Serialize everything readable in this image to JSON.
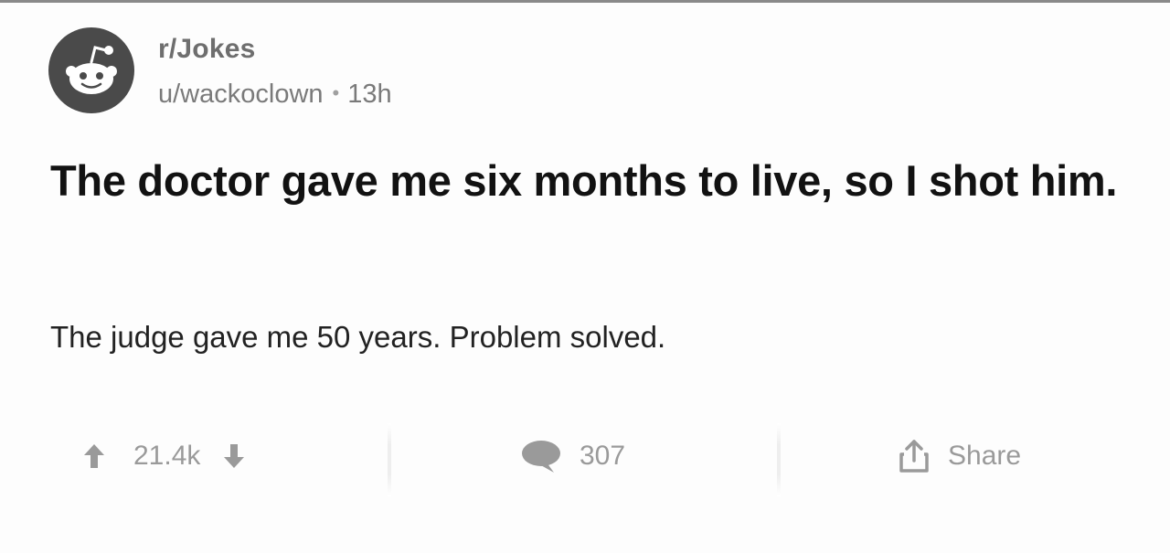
{
  "post": {
    "subreddit": "r/Jokes",
    "author": "u/wackoclown",
    "separator": "•",
    "age": "13h",
    "title": "The doctor gave me six months to live, so I shot him.",
    "body": "The judge gave me 50 years. Problem solved."
  },
  "actions": {
    "score": "21.4k",
    "comments": "307",
    "share_label": "Share"
  },
  "icons": {
    "avatar": "reddit-snoo-icon",
    "upvote": "upvote-arrow-icon",
    "downvote": "downvote-arrow-icon",
    "comment": "comment-bubble-icon",
    "share": "share-icon"
  },
  "colors": {
    "title": "#121212",
    "meta": "#7a7a7a",
    "action": "#9a9a9a",
    "avatar_bg": "#4a4a4a"
  }
}
